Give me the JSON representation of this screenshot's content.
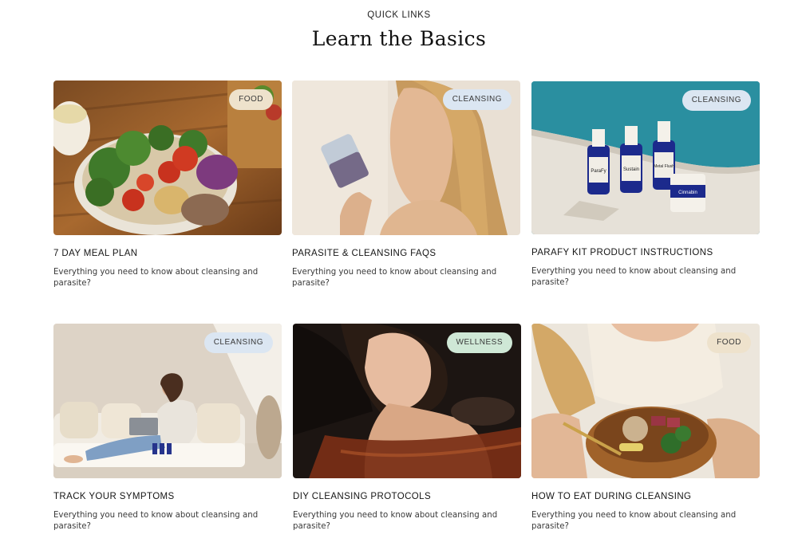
{
  "section": {
    "eyebrow": "QUICK LINKS",
    "title": "Learn the Basics"
  },
  "badge_colors": {
    "food": "#eee2cc",
    "cleansing": "#dbe6f2",
    "wellness": "#cfe8d6"
  },
  "cards": [
    {
      "tag": "FOOD",
      "title": "7 DAY MEAL PLAN",
      "description": "Everything you need to know about cleansing and parasite?",
      "image": "salad-bowl-image"
    },
    {
      "tag": "CLEANSING",
      "title": "PARASITE & CLEANSING FAQS",
      "description": "Everything you need to know about cleansing and parasite?",
      "image": "woman-drinking-image"
    },
    {
      "tag": "CLEANSING",
      "title": "PARAFY KIT PRODUCT INSTRUCTIONS",
      "description": "Everything you need to know about cleansing and parasite?",
      "image": "product-bottles-poolside-image",
      "product_labels": [
        "ParaFy",
        "Sustain",
        "Metal Flush",
        "Cinnabin"
      ]
    },
    {
      "tag": "CLEANSING",
      "title": "TRACK YOUR SYMPTOMS",
      "description": "Everything you need to know about cleansing and parasite?",
      "image": "woman-on-sofa-laptop-image"
    },
    {
      "tag": "WELLNESS",
      "title": "DIY CLEANSING PROTOCOLS",
      "description": "Everything you need to know about cleansing and parasite?",
      "image": "woman-in-bath-image"
    },
    {
      "tag": "FOOD",
      "title": "HOW TO EAT DURING CLEANSING",
      "description": "Everything you need to know about cleansing and parasite?",
      "image": "woman-eating-bowl-image"
    }
  ]
}
